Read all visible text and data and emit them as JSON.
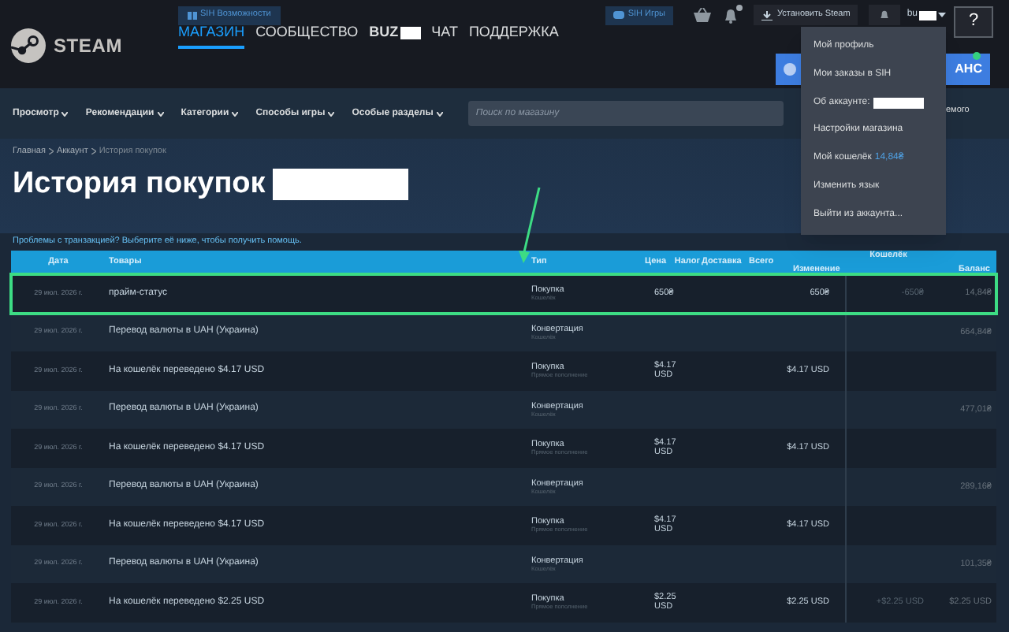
{
  "top_bar": {
    "sih_button": "SIH Возможности",
    "sih_games": "SIH Игры",
    "install_button": "Установить Steam",
    "username": "bu",
    "help": "?"
  },
  "logo": "STEAM",
  "main_nav": [
    {
      "label": "МАГАЗИН",
      "selected": true
    },
    {
      "label": "СООБЩЕСТВО",
      "selected": false
    },
    {
      "label": "BUZ",
      "selected": false,
      "redacted": true
    },
    {
      "label": "ЧАТ",
      "selected": false
    },
    {
      "label": "ПОДДЕРЖКА",
      "selected": false
    }
  ],
  "promo_button": "АНС",
  "store_nav": [
    "Просмотр",
    "Рекомендации",
    "Категории",
    "Способы игры",
    "Особые разделы"
  ],
  "search": {
    "placeholder": "Поиск по магазину"
  },
  "store_nav_tail": "емого",
  "account_menu": [
    {
      "label": "Мой профиль"
    },
    {
      "label": "Мои заказы в SIH"
    },
    {
      "label": "Об аккаунте:",
      "redacted": true
    },
    {
      "label": "Настройки магазина"
    },
    {
      "label": "Мой кошелёк",
      "value": "14,84₴"
    },
    {
      "label": "Изменить язык"
    },
    {
      "label": "Выйти из аккаунта..."
    }
  ],
  "breadcrumbs": [
    "Главная",
    "Аккаунт",
    "История покупок"
  ],
  "title": "История покупок",
  "help_link": "Проблемы с транзакцией? Выберите её ниже, чтобы получить помощь.",
  "table": {
    "columns": [
      "Дата",
      "Товары",
      "Тип",
      "Цена",
      "Налог",
      "Доставка",
      "Всего"
    ],
    "wallet_header": "Кошелёк",
    "wallet_columns": [
      "Изменение",
      "Баланс"
    ],
    "rows": [
      {
        "date": "29 июл. 2026 г.",
        "item": "прайм-статус",
        "type": "Покупка",
        "type_sub": "Кошелёк",
        "price": "650₴",
        "total": "650₴",
        "change": "-650₴",
        "balance": "14,84₴",
        "highlighted": true
      },
      {
        "date": "29 июл. 2026 г.",
        "item": "Перевод валюты в UAH (Украина)",
        "type": "Конвертация",
        "type_sub": "Кошелёк",
        "balance": "664,84₴",
        "highlighted": false
      },
      {
        "date": "29 июл. 2026 г.",
        "item": "На кошелёк переведено $4.17 USD",
        "type": "Покупка",
        "type_sub": "Прямое пополнение",
        "price": "$4.17 USD",
        "total": "$4.17 USD",
        "highlighted": false
      },
      {
        "date": "29 июл. 2026 г.",
        "item": "Перевод валюты в UAH (Украина)",
        "type": "Конвертация",
        "type_sub": "Кошелёк",
        "balance": "477,01₴",
        "highlighted": false
      },
      {
        "date": "29 июл. 2026 г.",
        "item": "На кошелёк переведено $4.17 USD",
        "type": "Покупка",
        "type_sub": "Прямое пополнение",
        "price": "$4.17 USD",
        "total": "$4.17 USD",
        "highlighted": false
      },
      {
        "date": "29 июл. 2026 г.",
        "item": "Перевод валюты в UAH (Украина)",
        "type": "Конвертация",
        "type_sub": "Кошелёк",
        "balance": "289,16₴",
        "highlighted": false
      },
      {
        "date": "29 июл. 2026 г.",
        "item": "На кошелёк переведено $4.17 USD",
        "type": "Покупка",
        "type_sub": "Прямое пополнение",
        "price": "$4.17 USD",
        "total": "$4.17 USD",
        "highlighted": false
      },
      {
        "date": "29 июл. 2026 г.",
        "item": "Перевод валюты в UAH (Украина)",
        "type": "Конвертация",
        "type_sub": "Кошелёк",
        "balance": "101,35₴",
        "highlighted": false
      },
      {
        "date": "29 июл. 2026 г.",
        "item": "На кошелёк переведено $2.25 USD",
        "type": "Покупка",
        "type_sub": "Прямое пополнение",
        "price": "$2.25 USD",
        "total": "$2.25 USD",
        "change": "+$2.25 USD",
        "balance": "$2.25 USD",
        "highlighted": false
      }
    ]
  }
}
